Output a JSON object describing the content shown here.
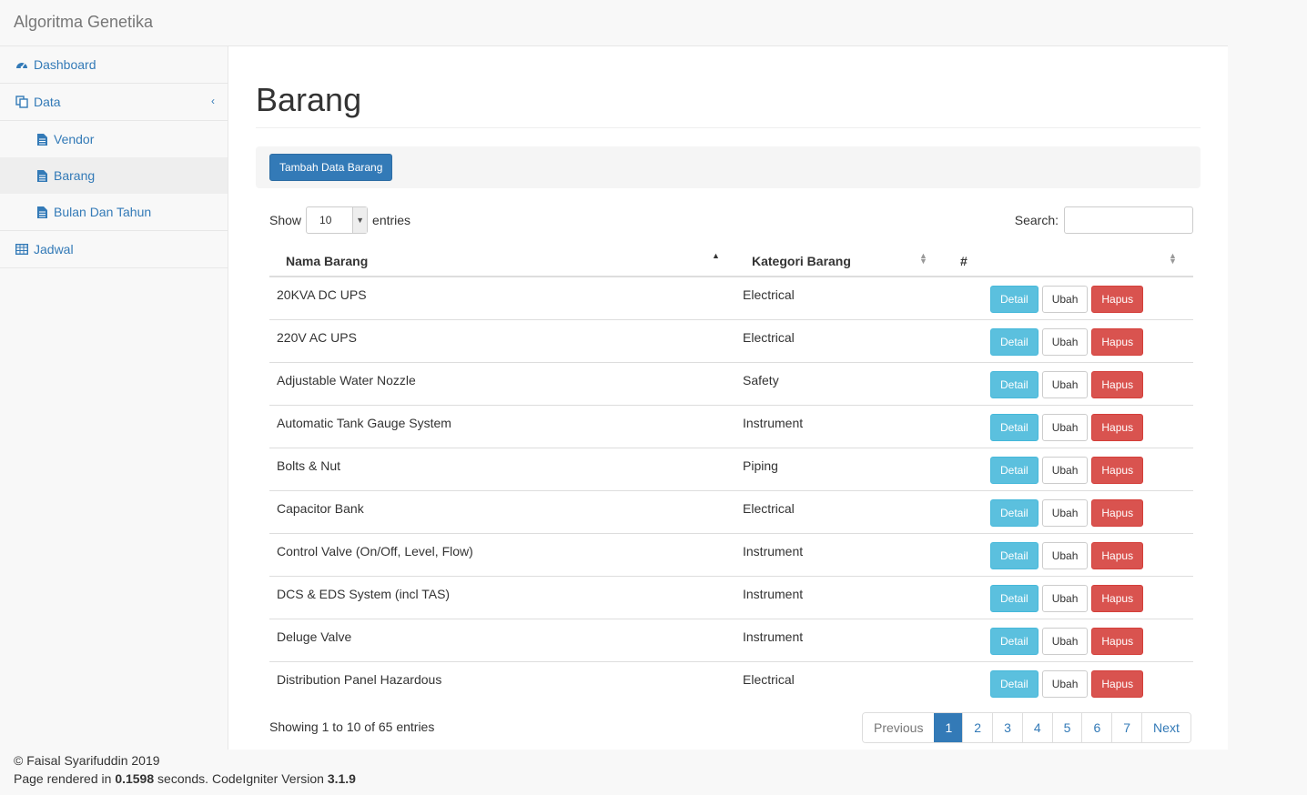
{
  "app": {
    "title": "Algoritma Genetika"
  },
  "sidebar": {
    "dashboard": "Dashboard",
    "data": "Data",
    "vendor": "Vendor",
    "barang": "Barang",
    "bulan": "Bulan Dan Tahun",
    "jadwal": "Jadwal"
  },
  "page": {
    "title": "Barang",
    "add_button": "Tambah Data Barang",
    "show_label": "Show",
    "entries_value": "10",
    "entries_label": "entries",
    "search_label": "Search:",
    "info": "Showing 1 to 10 of 65 entries"
  },
  "table": {
    "headers": [
      "Nama Barang",
      "Kategori Barang",
      "#"
    ],
    "actions": {
      "detail": "Detail",
      "edit": "Ubah",
      "delete": "Hapus"
    },
    "rows": [
      [
        "20KVA DC UPS",
        "Electrical"
      ],
      [
        "220V AC UPS",
        "Electrical"
      ],
      [
        "Adjustable Water Nozzle",
        "Safety"
      ],
      [
        "Automatic Tank Gauge System",
        "Instrument"
      ],
      [
        "Bolts & Nut",
        "Piping"
      ],
      [
        "Capacitor Bank",
        "Electrical"
      ],
      [
        "Control Valve (On/Off, Level, Flow)",
        "Instrument"
      ],
      [
        "DCS & EDS System (incl TAS)",
        "Instrument"
      ],
      [
        "Deluge Valve",
        "Instrument"
      ],
      [
        "Distribution Panel Hazardous",
        "Electrical"
      ]
    ]
  },
  "pagination": {
    "previous": "Previous",
    "pages": [
      "1",
      "2",
      "3",
      "4",
      "5",
      "6",
      "7"
    ],
    "next": "Next"
  },
  "footer": {
    "copyright": "© Faisal Syarifuddin 2019",
    "rendered_prefix": "Page rendered in ",
    "time": "0.1598",
    "rendered_mid": " seconds. CodeIgniter Version ",
    "version": "3.1.9"
  },
  "colors": {
    "primary": "#337ab7",
    "info": "#5bc0de",
    "danger": "#d9534f"
  }
}
